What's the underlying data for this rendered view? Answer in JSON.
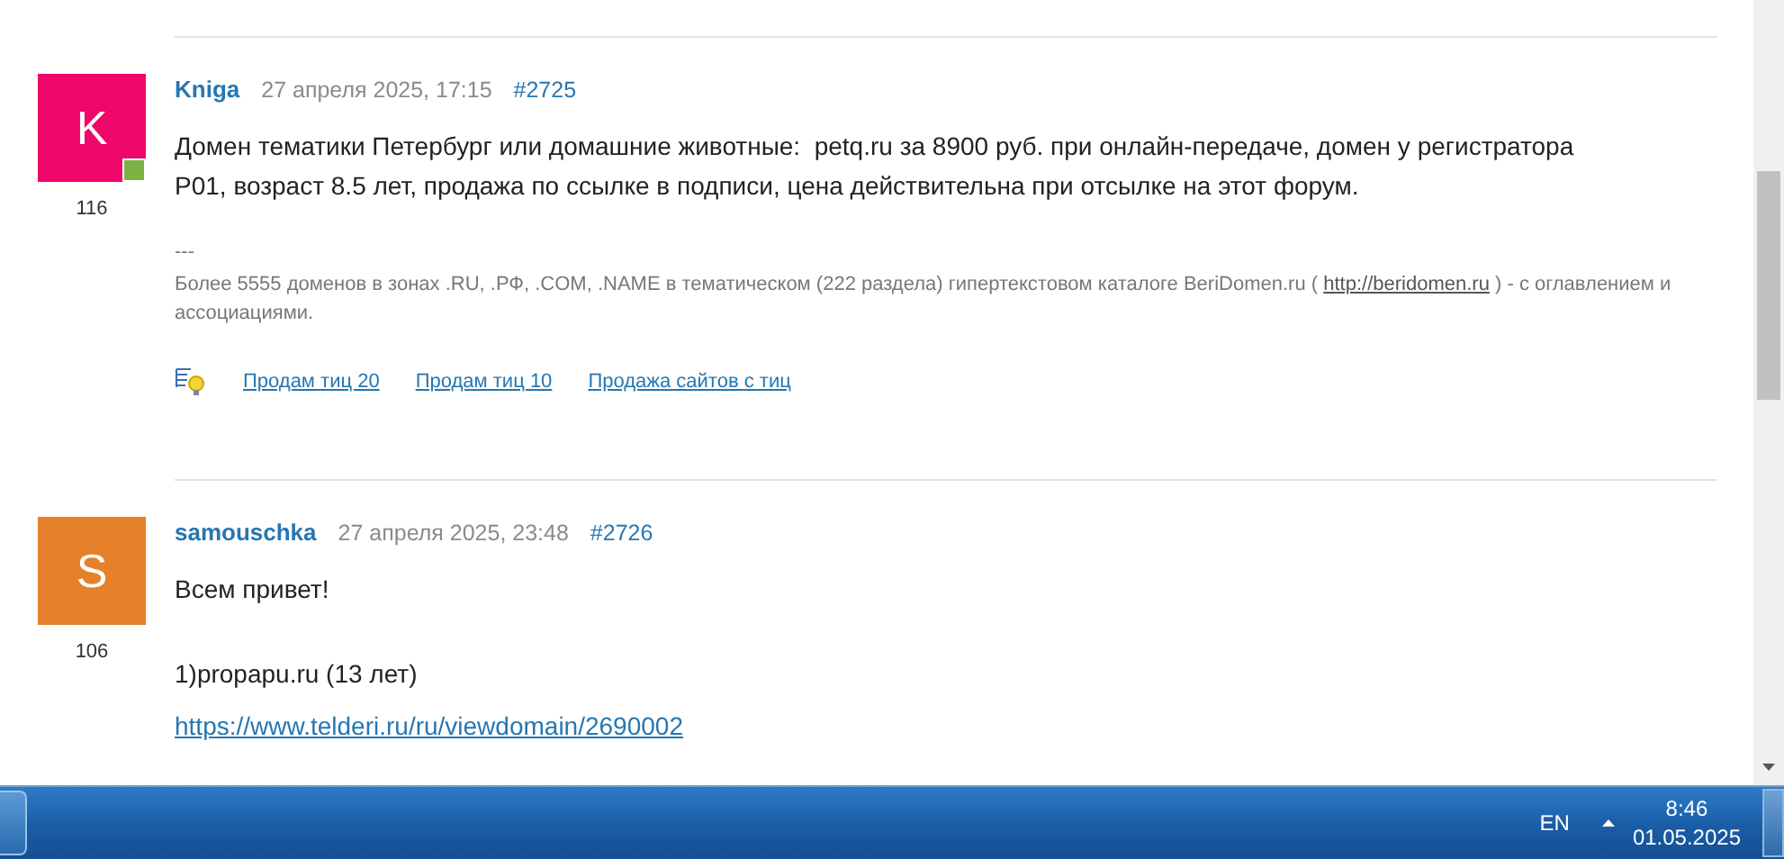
{
  "posts": [
    {
      "author": "Kniga",
      "avatar_letter": "K",
      "color": "#f0076a",
      "online": true,
      "rating": "116",
      "date": "27 апреля 2025, 17:15",
      "number": "#2725",
      "blocks": [
        {
          "kind": "text",
          "text": "Домен тематики Петербург или домашние животные:  petq.ru за 8900 руб. при онлайн-передаче, домен у регистратора Р01, возраст 8.5 лет, продажа по ссылке в подписи, цена действительна при отсылке на этот форум."
        }
      ],
      "signature": {
        "separator": "---",
        "before": "Более 5555 доменов в зонах .RU, .РФ, .COM, .NAME в тематическом (222 раздела) гипертекстовом каталоге BeriDomen.ru ( ",
        "link": "http://beridomen.ru",
        "after": " ) - с оглавлением и ассоциациями."
      },
      "ad_links": [
        "Продам тиц 20",
        "Продам тиц 10",
        "Продажа сайтов с тиц"
      ]
    },
    {
      "author": "samouschka",
      "avatar_letter": "S",
      "color": "#e5812a",
      "online": false,
      "rating": "106",
      "date": "27 апреля 2025, 23:48",
      "number": "#2726",
      "blocks": [
        {
          "kind": "text",
          "text": "Всем привет!"
        },
        {
          "kind": "gap"
        },
        {
          "kind": "text",
          "text": "1)propapu.ru (13 лет)"
        },
        {
          "kind": "link",
          "text": "https://www.telderi.ru/ru/viewdomain/2690002"
        }
      ]
    }
  ],
  "taskbar": {
    "language": "EN",
    "time": "8:46",
    "date": "01.05.2025"
  }
}
